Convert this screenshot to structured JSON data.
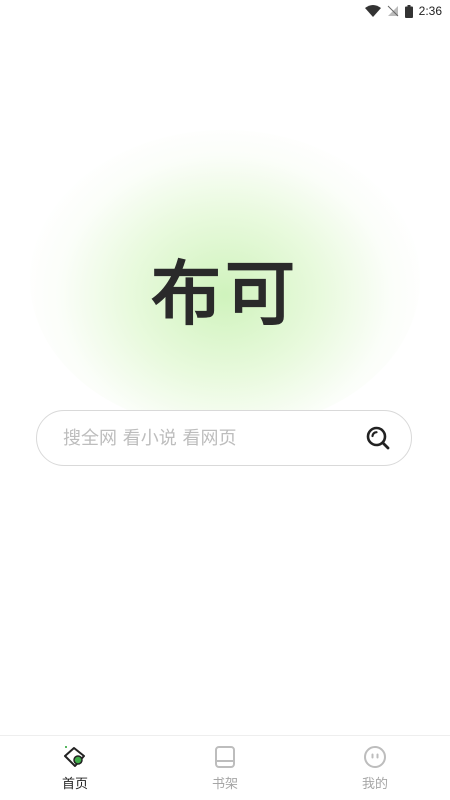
{
  "status_bar": {
    "time": "2:36",
    "icons": [
      "wifi-icon",
      "signal-icon",
      "battery-icon"
    ]
  },
  "logo": {
    "text": "布可"
  },
  "search": {
    "placeholder": "搜全网 看小说 看网页",
    "icon": "search-icon"
  },
  "bottom_nav": {
    "items": [
      {
        "label": "首页",
        "icon": "home-icon",
        "active": true
      },
      {
        "label": "书架",
        "icon": "bookshelf-icon",
        "active": false
      },
      {
        "label": "我的",
        "icon": "profile-icon",
        "active": false
      }
    ]
  },
  "colors": {
    "accent_green": "#3fae49",
    "glow_green": "#cdf2b9",
    "text_dark": "#2a2a2a",
    "text_inactive": "#a6a6a6"
  }
}
